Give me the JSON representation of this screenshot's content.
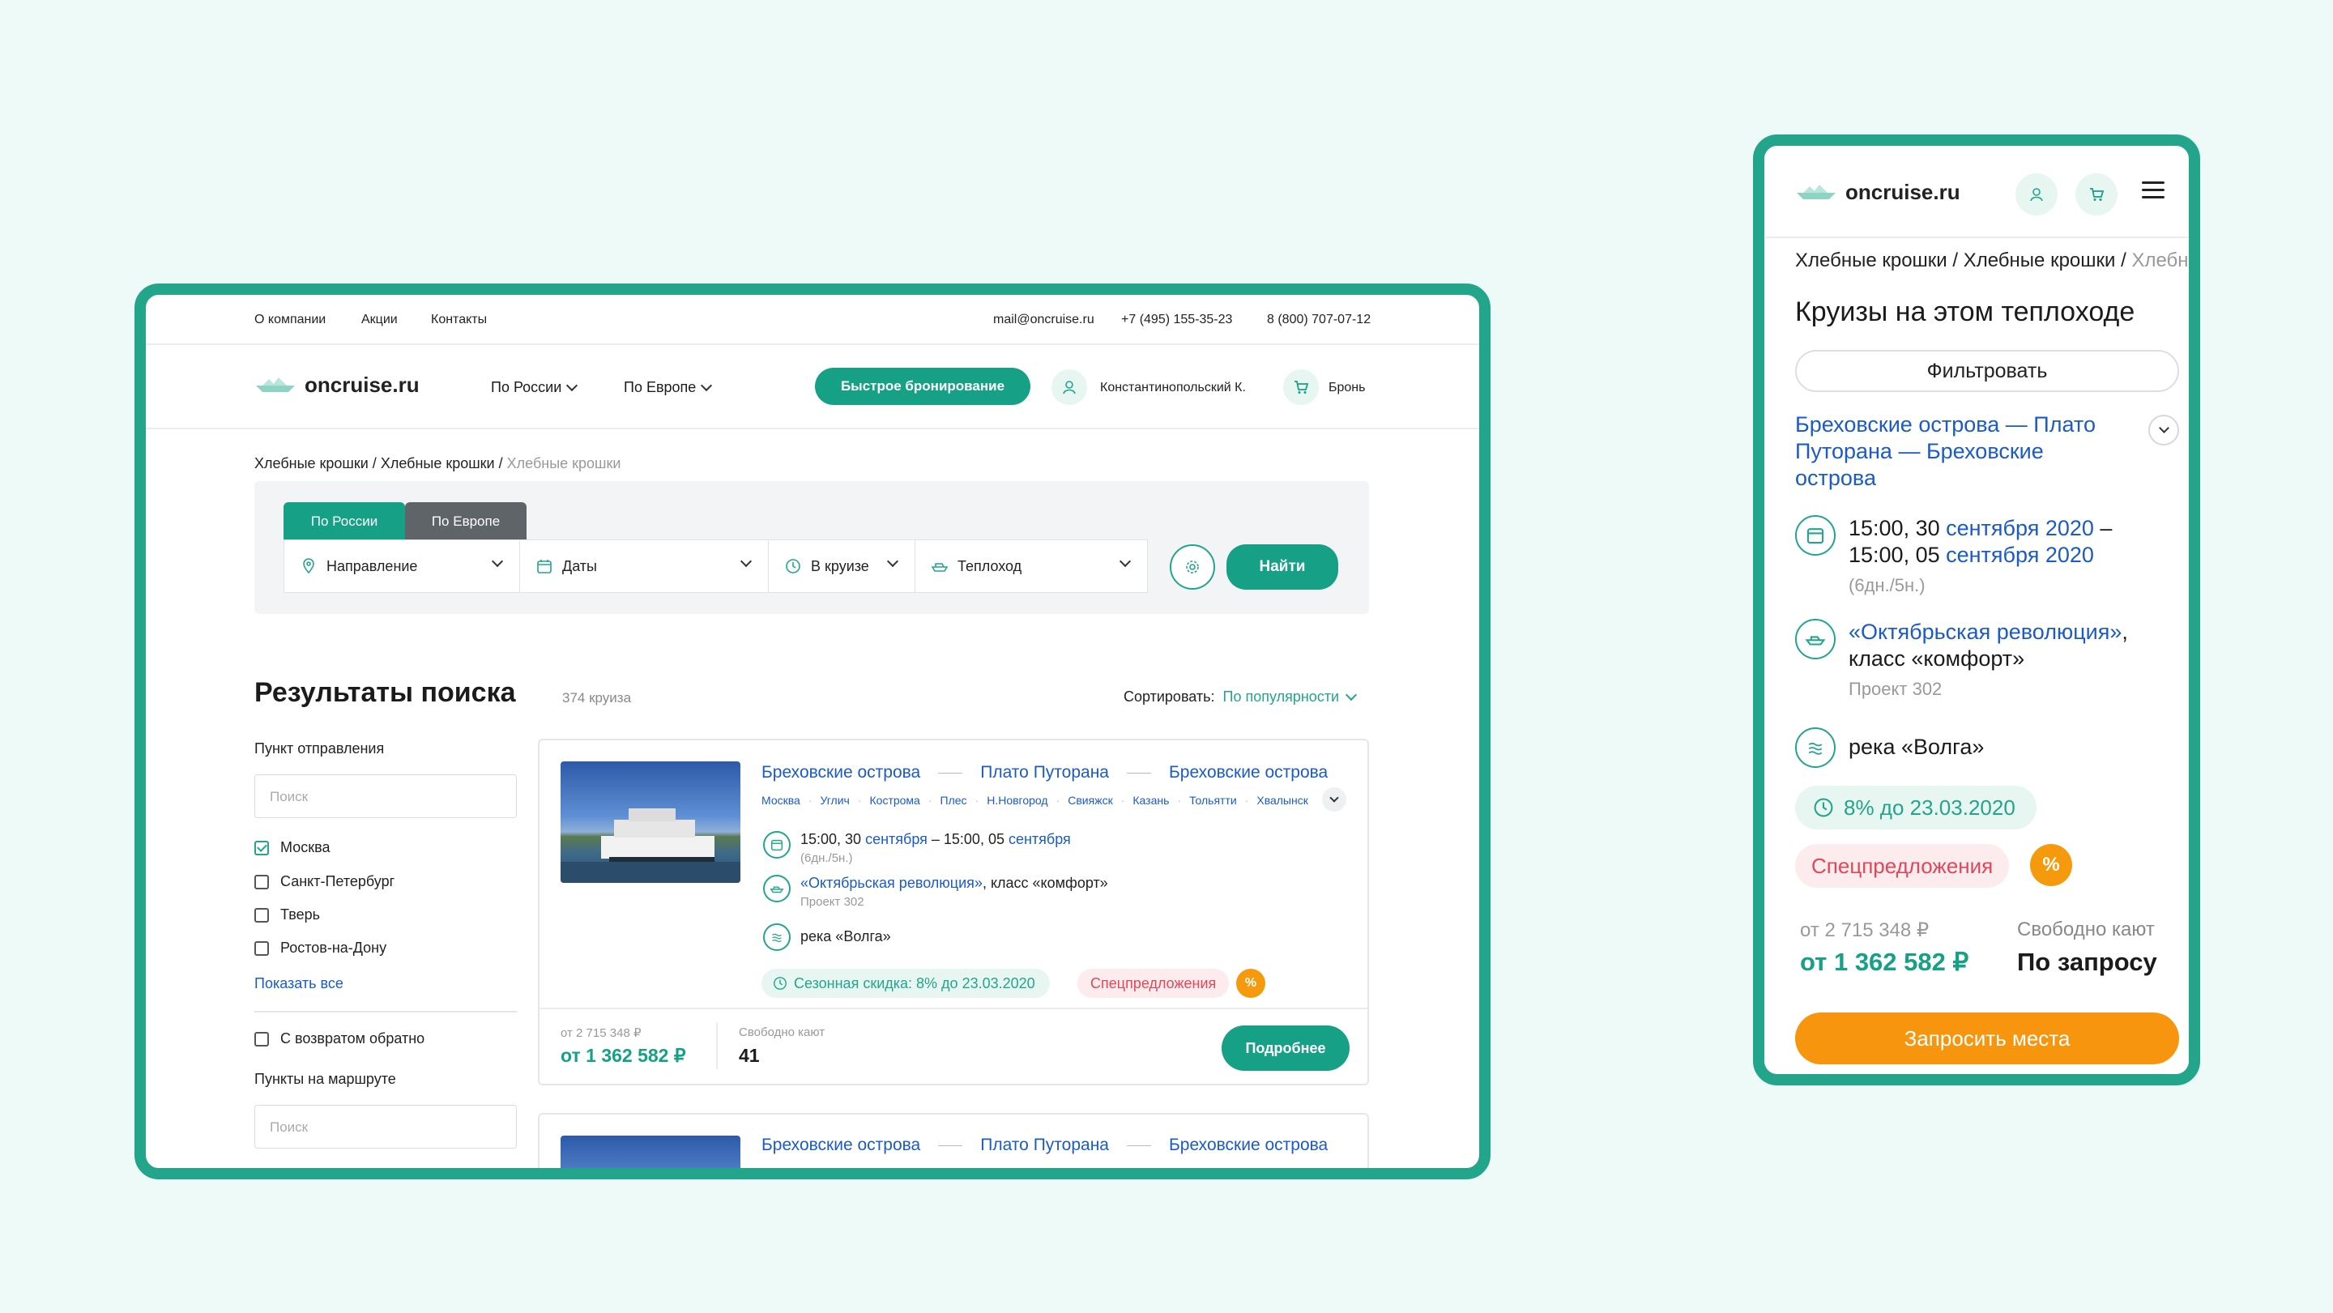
{
  "desktop": {
    "topbar": {
      "links": [
        "О компании",
        "Акции",
        "Контакты"
      ],
      "email": "mail@oncruise.ru",
      "phone1": "+7 (495) 155-35-23",
      "phone2": "8 (800) 707-07-12"
    },
    "header": {
      "logo": "oncruise.ru",
      "nav": [
        "По России",
        "По Европе"
      ],
      "quick_booking": "Быстрое бронирование",
      "user": "Константинопольский К.",
      "cart": "Бронь"
    },
    "breadcrumbs": [
      "Хлебные крошки",
      "Хлебные крошки",
      "Хлебные крошки"
    ],
    "search": {
      "tabs": [
        "По России",
        "По Европе"
      ],
      "fields": {
        "direction": "Направление",
        "dates": "Даты",
        "duration": "В круизе",
        "ship": "Теплоход"
      },
      "submit": "Найти"
    },
    "results": {
      "title": "Результаты поиска",
      "count": "374 круиза",
      "sort_label": "Сортировать:",
      "sort_value": "По популярности"
    },
    "filters": {
      "departure_title": "Пункт отправления",
      "search_placeholder": "Поиск",
      "cities": [
        {
          "label": "Москва",
          "checked": true
        },
        {
          "label": "Санкт-Петербург",
          "checked": false
        },
        {
          "label": "Тверь",
          "checked": false
        },
        {
          "label": "Ростов-на-Дону",
          "checked": false
        }
      ],
      "show_all": "Показать все",
      "return": "С возвратом обратно",
      "route_points_title": "Пункты на маршруте"
    },
    "card": {
      "route": [
        "Бреховские острова",
        "Плато Путорана",
        "Бреховские острова"
      ],
      "stops": [
        "Москва",
        "Углич",
        "Кострома",
        "Плес",
        "Н.Новгород",
        "Свияжск",
        "Казань",
        "Тольятти",
        "Хвалынск"
      ],
      "dates_a": "15:00, 30 ",
      "dates_month1": "сентября",
      "dates_b": " – 15:00, 05 ",
      "dates_month2": "сентября",
      "duration": "(6дн./5н.)",
      "ship_name": "«Октябрьская революция»",
      "ship_class": ", класс «комфорт»",
      "project": "Проект 302",
      "river": "река «Волга»",
      "discount": "Сезонная скидка: 8% до 23.03.2020",
      "special": "Спецпредложения",
      "pct": "%",
      "old_price": "от 2 715 348 ₽",
      "price": "от 1 362 582 ₽",
      "cabins_label": "Свободно кают",
      "cabins": "41",
      "more": "Подробнее"
    },
    "card2_route": [
      "Бреховские острова",
      "Плато Путорана",
      "Бреховские острова"
    ]
  },
  "mobile": {
    "logo": "oncruise.ru",
    "breadcrumbs": "Хлебные крошки / Хлебные крошки / ",
    "breadcrumbs_last": "Хлебные",
    "title": "Круизы на этом теплоходе",
    "filter": "Фильтровать",
    "route": "Бреховские острова — Плато Путорана — Бреховские острова",
    "date1_a": "15:00, 30 ",
    "date1_m": "сентября 2020",
    "date1_b": " –",
    "date2_a": "15:00, 05 ",
    "date2_m": "сентября 2020",
    "duration": "(6дн./5н.)",
    "ship_name": "«Октябрьская революция»",
    "ship_class": ", класс «комфорт»",
    "project": "Проект 302",
    "river": "река «Волга»",
    "discount": "8% до 23.03.2020",
    "special": "Спецпредложения",
    "pct": "%",
    "old_price": "от 2 715 348 ₽",
    "price": "от 1 362 582 ₽",
    "cabins_label": "Свободно кают",
    "cabins": "По запросу",
    "request": "Запросить места"
  },
  "colors": {
    "accent": "#16a085",
    "frame": "#22a58b",
    "link": "#1a5bc8",
    "orange": "#f59a0c",
    "special": "#e0485a"
  }
}
